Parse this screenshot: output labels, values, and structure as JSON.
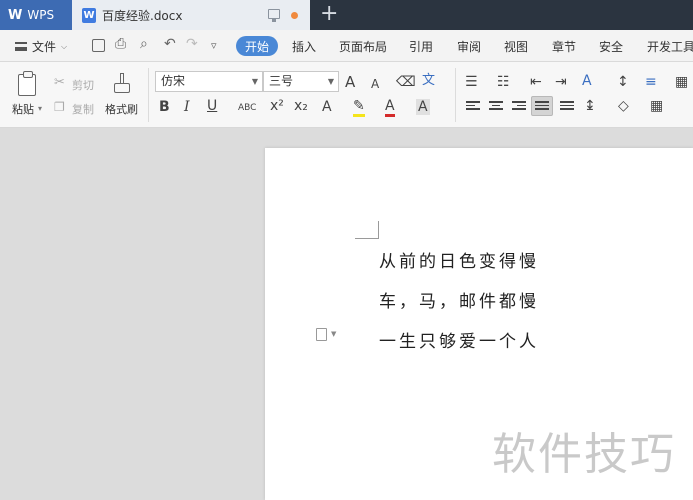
{
  "titlebar": {
    "app_name": "WPS",
    "app_logo": "W",
    "doc_icon_letter": "W",
    "doc_title": "百度经验.docx",
    "new_tab": "+"
  },
  "menubar": {
    "file_label": "文件",
    "tabs": [
      "开始",
      "插入",
      "页面布局",
      "引用",
      "审阅",
      "视图",
      "章节",
      "安全",
      "开发工具"
    ]
  },
  "toolbar": {
    "paste_label": "粘贴",
    "cut_label": "剪切",
    "copy_label": "复制",
    "format_painter_label": "格式刷",
    "font_name": "仿宋",
    "font_size": "三号",
    "bold": "B",
    "italic": "I",
    "underline": "U",
    "abc": "ABC",
    "font_grow": "A",
    "font_shrink": "A"
  },
  "document": {
    "lines": [
      "从前的日色变得慢",
      "车，马，邮件都慢",
      "一生只够爱一个人"
    ]
  },
  "watermark": "软件技巧",
  "colors": {
    "accent": "#4a88d6",
    "titlebar": "#2b3440",
    "wps_tab": "#3d6bb3"
  }
}
